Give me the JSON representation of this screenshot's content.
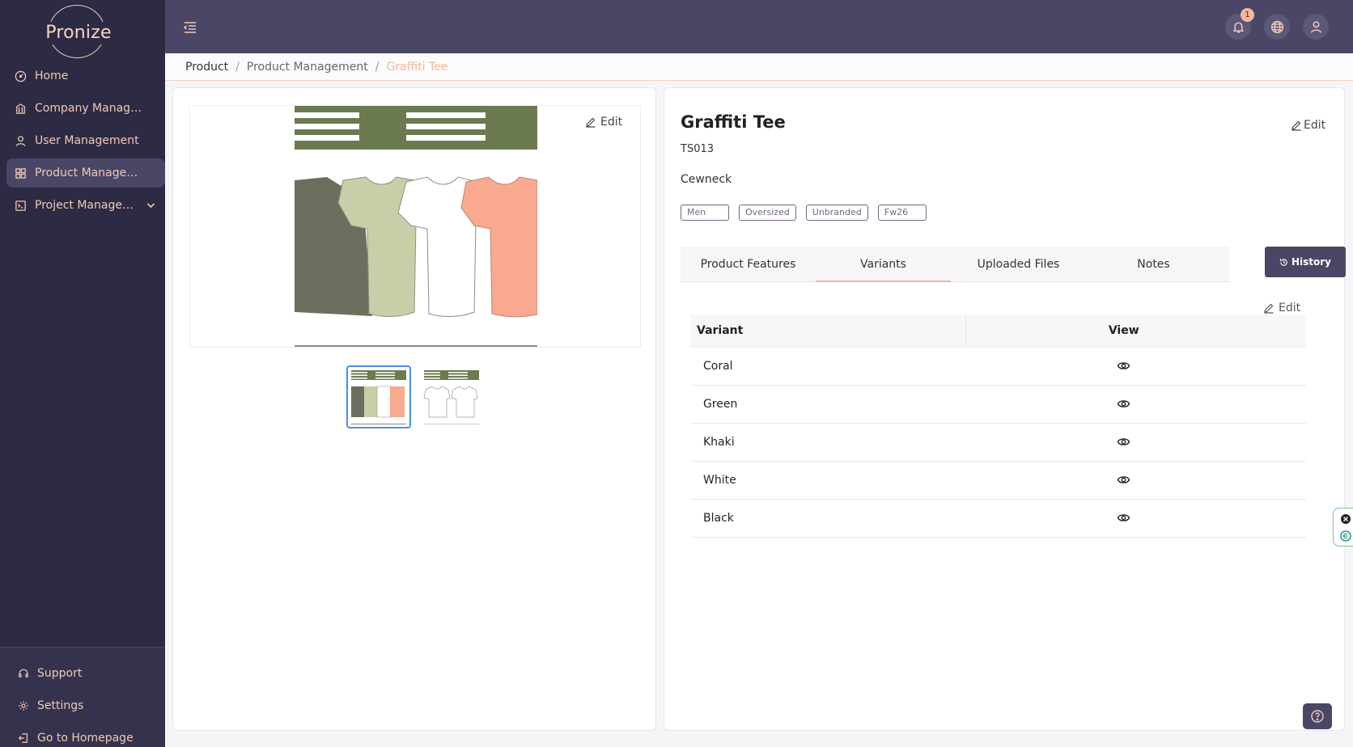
{
  "app": {
    "logo_text": "Pronize"
  },
  "sidebar": {
    "items": [
      {
        "label": "Home",
        "icon": "dashboard-icon"
      },
      {
        "label": "Company Managem...",
        "icon": "building-icon"
      },
      {
        "label": "User Management",
        "icon": "user-icon"
      },
      {
        "label": "Product Management",
        "icon": "grid-icon",
        "active": true
      },
      {
        "label": "Project Managem...",
        "icon": "project-icon"
      }
    ],
    "bottom": [
      {
        "label": "Support",
        "icon": "headset-icon"
      },
      {
        "label": "Settings",
        "icon": "gear-icon"
      },
      {
        "label": "Go to Homepage",
        "icon": "exit-icon"
      }
    ]
  },
  "topbar": {
    "notification_count": "1"
  },
  "breadcrumb": {
    "root": "Product",
    "section": "Product Management",
    "current": "Graffiti Tee",
    "separator": "/"
  },
  "image_panel": {
    "edit_label": "Edit",
    "garment_colors": [
      "#6b6f5e",
      "#c7cfa9",
      "#ffffff",
      "#f8a98f"
    ],
    "header_color": "#6b7a4f"
  },
  "product": {
    "name": "Graffiti Tee",
    "code": "TS013",
    "neckline": "Cewneck",
    "edit_label": "Edit",
    "tags": [
      "Men",
      "Oversized",
      "Unbranded",
      "Fw26"
    ]
  },
  "tabs": [
    {
      "label": "Product Features"
    },
    {
      "label": "Variants",
      "active": true
    },
    {
      "label": "Uploaded Files"
    },
    {
      "label": "Notes"
    }
  ],
  "history_label": "History",
  "variants": {
    "edit_label": "Edit",
    "columns": [
      "Variant",
      "View"
    ],
    "rows": [
      "Coral",
      "Green",
      "Khaki",
      "White",
      "Black"
    ]
  },
  "colors": {
    "sidebar_bg": "#2d2a43",
    "topbar_bg": "#4a4666",
    "accent": "#f4b69c"
  }
}
